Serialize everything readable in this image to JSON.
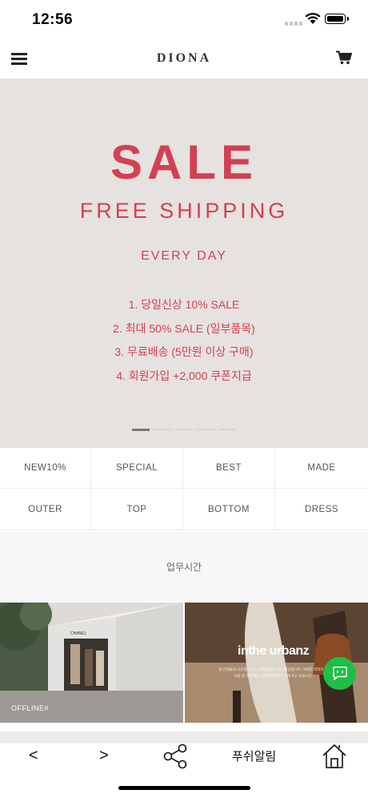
{
  "status": {
    "time": "12:56"
  },
  "header": {
    "logo": "DIONA",
    "menu_icon": "hamburger-icon",
    "cart_icon": "cart-icon"
  },
  "banner": {
    "title": "SALE",
    "subtitle": "FREE SHIPPING",
    "tagline": "EVERY DAY",
    "items": [
      "1. 당일신상 10% SALE",
      "2. 최대 50% SALE (일부품목)",
      "3. 무료배송 (5만원 이상 구매)",
      "4. 회원가입 +2,000 쿠폰지급"
    ],
    "color": "#d34054",
    "slide_count": 5,
    "active_slide": 1
  },
  "categories": [
    "NEW10%",
    "SPECIAL",
    "BEST",
    "MADE",
    "OUTER",
    "TOP",
    "BOTTOM",
    "DRESS"
  ],
  "hours_label": "업무시간",
  "photos": {
    "left_caption": "OFFLINE#",
    "left_sign": "CHANEL",
    "right_title": "inthe urbanz",
    "right_sub": "본 인쇄물의 사진과 문구는 인더어반즈 에서 제공합니다. 어떠한 목적으로 사용 할 경우에는 인더어반즈에서 가져가고 있습니다"
  },
  "chat_color": "#1fbf46",
  "bottom_nav": {
    "prev": "<",
    "next": ">",
    "share_icon": "share-icon",
    "push_label": "푸쉬알림",
    "home_icon": "home-icon"
  }
}
